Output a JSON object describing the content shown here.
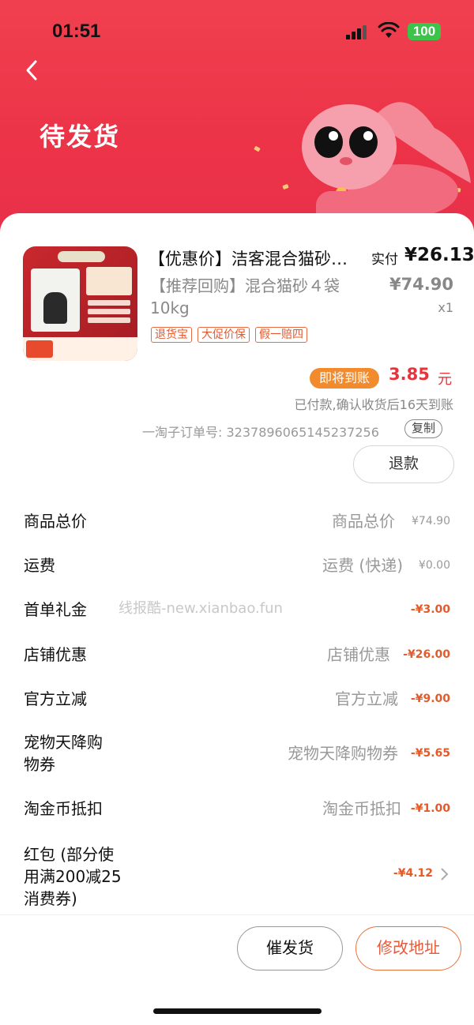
{
  "status_bar": {
    "time": "01:51",
    "battery": "100"
  },
  "header": {
    "title": "待发货"
  },
  "product": {
    "title": "【优惠价】洁客混合猫砂…",
    "paid_label": "实付",
    "paid_amount": "¥26.13",
    "sku": "【推荐回购】混合猫砂４袋10kg",
    "original_price": "¥74.90",
    "quantity": "x1",
    "tags": [
      "退货宝",
      "大促价保",
      "假一赔四"
    ]
  },
  "settlement": {
    "badge": "即将到账",
    "amount": "3.85",
    "unit": "元",
    "note": "已付款,确认收货后16天到账"
  },
  "order": {
    "number_text": "一淘子订单号: 3237896065145237256",
    "copy_label": "复制",
    "refund_label": "退款"
  },
  "price_rows": [
    {
      "label": "商品总价",
      "sub": "商品总价",
      "amount": "¥74.90"
    },
    {
      "label": "运费",
      "sub": "运费 (快递)",
      "amount": "¥0.00"
    },
    {
      "label": "首单礼金",
      "sub": "",
      "amount": "-¥3.00"
    },
    {
      "label": "店铺优惠",
      "sub": "店铺优惠",
      "amount": "-¥26.00"
    },
    {
      "label": "官方立减",
      "sub": "官方立减",
      "amount": "-¥9.00"
    },
    {
      "label": "宠物天降购物券",
      "sub": "宠物天降购物券",
      "amount": "-¥5.65"
    },
    {
      "label": "淘金币抵扣",
      "sub": "淘金币抵扣",
      "amount": "-¥1.00"
    },
    {
      "label": "红包 (部分使用满200减25消费券)",
      "sub": "",
      "amount": "-¥4.12"
    }
  ],
  "watermark": "线报酷-new.xianbao.fun",
  "actions": {
    "urge": "催发货",
    "change_address": "修改地址"
  },
  "colors": {
    "header_red": "#ec3348",
    "accent_orange": "#e8593a",
    "badge_orange": "#f28b2d",
    "amount_red": "#e8333a"
  }
}
